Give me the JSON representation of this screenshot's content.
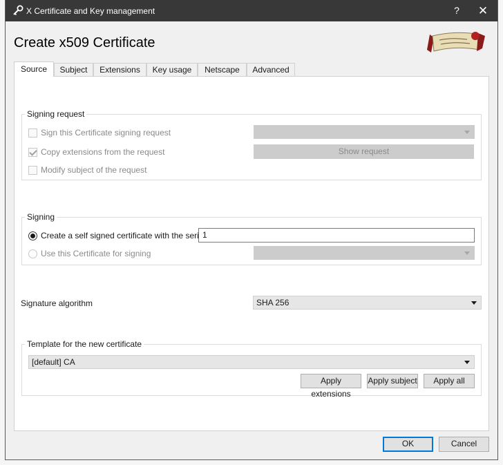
{
  "window": {
    "title": "X Certificate and Key management",
    "help_label": "?",
    "close_label": "✕"
  },
  "heading": "Create x509 Certificate",
  "tabs": [
    {
      "label": "Source",
      "active": true
    },
    {
      "label": "Subject"
    },
    {
      "label": "Extensions"
    },
    {
      "label": "Key usage"
    },
    {
      "label": "Netscape"
    },
    {
      "label": "Advanced"
    }
  ],
  "signing_request": {
    "title": "Signing request",
    "sign_csr_label": "Sign this Certificate signing request",
    "sign_csr_checked": false,
    "copy_ext_label": "Copy extensions from the request",
    "copy_ext_checked": true,
    "modify_subject_label": "Modify subject of the request",
    "modify_subject_checked": false,
    "request_select_value": "",
    "show_request_label": "Show request"
  },
  "signing": {
    "title": "Signing",
    "self_signed_label": "Create a self signed certificate with the serial",
    "serial_value": "1",
    "use_cert_label": "Use this Certificate for signing",
    "cert_select_value": ""
  },
  "signature": {
    "label": "Signature algorithm",
    "value": "SHA 256"
  },
  "template": {
    "title": "Template for the new certificate",
    "value": "[default] CA",
    "apply_extensions_label": "Apply extensions",
    "apply_subject_label": "Apply subject",
    "apply_all_label": "Apply all"
  },
  "footer": {
    "ok_label": "OK",
    "cancel_label": "Cancel"
  },
  "colors": {
    "titlebar": "#383838",
    "default_button_border": "#0078d7"
  }
}
